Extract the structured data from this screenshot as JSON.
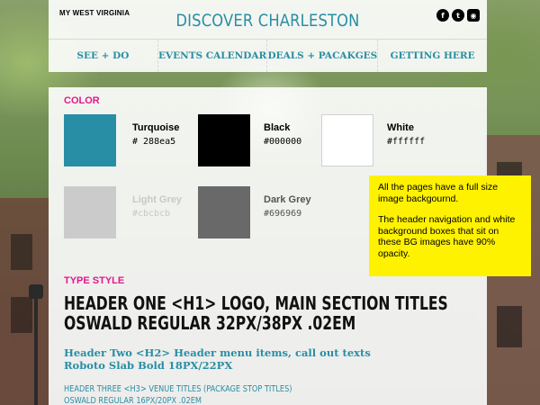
{
  "header": {
    "state": "MY WEST VIRGINIA",
    "logo": "DISCOVER CHARLESTON",
    "social": [
      {
        "icon": "facebook-icon",
        "glyph": "f"
      },
      {
        "icon": "twitter-icon",
        "glyph": "t"
      },
      {
        "icon": "instagram-icon",
        "glyph": "◉"
      }
    ]
  },
  "nav": {
    "items": [
      "SEE + DO",
      "EVENTS CALENDAR",
      "DEALS + PACAKGES",
      "GETTING HERE"
    ]
  },
  "color_section": {
    "label": "COLOR",
    "swatches": [
      {
        "name": "Turquoise",
        "hex": "# 288ea5",
        "color": "#288ea5"
      },
      {
        "name": "Black",
        "hex": "#000000",
        "color": "#000000"
      },
      {
        "name": "White",
        "hex": "#ffffff",
        "color": "#ffffff"
      },
      {
        "name": "Light Grey",
        "hex": "#cbcbcb",
        "color": "#cbcbcb"
      },
      {
        "name": "Dark Grey",
        "hex": "#696969",
        "color": "#696969"
      }
    ]
  },
  "type_section": {
    "label": "TYPE STYLE",
    "h1_line1": "HEADER ONE <H1> LOGO, MAIN SECTION TITLES",
    "h1_line2": "OSWALD REGULAR 32PX/38PX .02EM",
    "h2_line1": "Header Two <H2> Header menu items, call out texts",
    "h2_line2": "Roboto Slab Bold 18PX/22PX",
    "h3_line1": "HEADER THREE <H3> VENUE TITLES (PACKAGE STOP TITLES)",
    "h3_line2": "OSWALD REGULAR 16PX/20PX .02EM"
  },
  "note": {
    "p1": "All the pages have a full size image backgournd.",
    "p2": "The header navigation and white background boxes that sit on these BG images have 90% opacity."
  }
}
